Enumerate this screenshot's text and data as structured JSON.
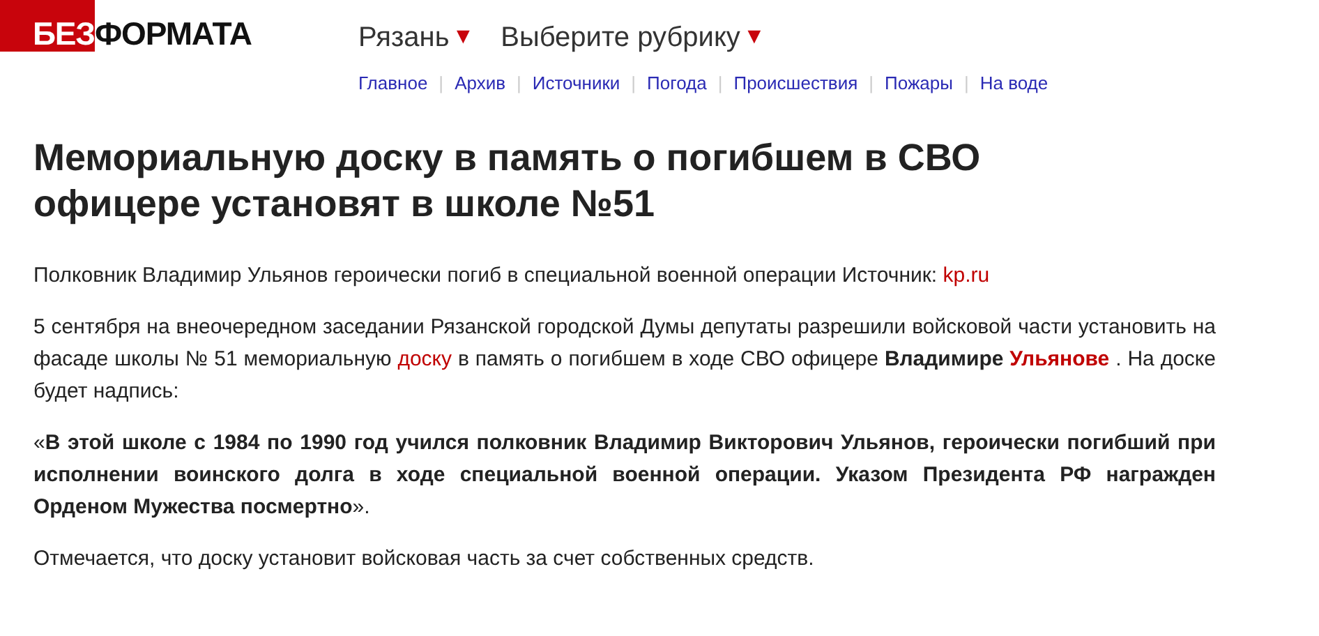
{
  "logo": {
    "red_part": "БЕЗ",
    "dark_part": "ФОРМАТА"
  },
  "selectors": [
    {
      "label": "Рязань",
      "caret": "▼"
    },
    {
      "label": "Выберите рубрику",
      "caret": "▼"
    }
  ],
  "nav": [
    "Главное",
    "Архив",
    "Источники",
    "Погода",
    "Происшествия",
    "Пожары",
    "На воде"
  ],
  "nav_separator": "|",
  "article": {
    "title": "Мемориальную доску в память о погибшем в СВО офицере установят в школе №51",
    "paragraphs": [
      {
        "segments": [
          {
            "kind": "text",
            "text": "Полковник Владимир Ульянов героически погиб в специальной военной операции Источник: "
          },
          {
            "kind": "link",
            "text": "kp.ru"
          }
        ]
      },
      {
        "segments": [
          {
            "kind": "text",
            "text": "5 сентября на внеочередном заседании Рязанской городской Думы депутаты разрешили войсковой части установить на фасаде школы № 51 мемориальную "
          },
          {
            "kind": "link",
            "text": "доску"
          },
          {
            "kind": "text",
            "text": " в память о погибшем в ходе СВО офицере "
          },
          {
            "kind": "bold",
            "text": "Владимире "
          },
          {
            "kind": "bold_link",
            "text": "Ульянове"
          },
          {
            "kind": "text",
            "text": " . На доске будет надпись:"
          }
        ]
      },
      {
        "segments": [
          {
            "kind": "rich",
            "text": "«**В этой школе с 1984 по 1990 год учился полковник Владимир Викторович Ульянов, героически погибший при исполнении воинского долга в ходе специальной военной операции. Указом Президента РФ награжден Орденом Мужества посмертно**»."
          }
        ]
      },
      {
        "segments": [
          {
            "kind": "text",
            "text": "Отмечается, что доску установит войсковая часть за счет собственных средств."
          }
        ]
      }
    ]
  }
}
